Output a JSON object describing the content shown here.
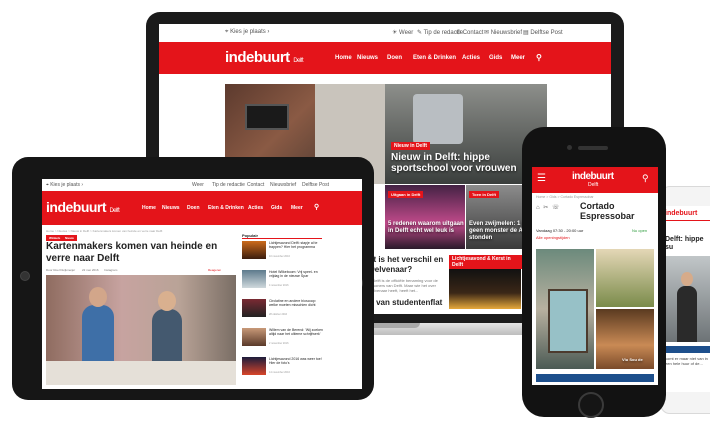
{
  "colors": {
    "brand_red": "#e4141a",
    "device_dark": "#161616"
  },
  "laptop": {
    "topbar": {
      "location": "Kies je plaats",
      "links": [
        "Weer",
        "Tip de redactie",
        "Contact",
        "Nieuwsbrief",
        "Delftse Post"
      ]
    },
    "logo": {
      "brand": "indebuurt",
      "city": "Delft"
    },
    "nav": [
      "Home",
      "Nieuws",
      "Doen",
      "Eten & Drinken",
      "Acties",
      "Gids",
      "Meer"
    ],
    "hero": {
      "tag": "Nieuw in Delft",
      "title": "Nieuw in Delft: hippe sportschool voor vrouwen"
    },
    "tiles": [
      {
        "tag": "Uitgaan in Delft",
        "title": "5 redenen waarom uitgaan in Delft echt wel leuk is"
      },
      {
        "tag": "Toen in Delft",
        "title": "Even zwijmelen: 1 nog geen monster de A13 stonden"
      }
    ],
    "article": {
      "title": "at is het verschil en Delvenaar?",
      "body": "n Delft is de officiële benaming voor de inwoners van Delft. Maar wie het over Delvenaar heeft, heeft het...",
      "footer": "n van studentenflat"
    },
    "side_tag": "Lichtjesavond & Kerst in Delft"
  },
  "tablet": {
    "topbar": {
      "location": "Kies je plaats",
      "links": [
        "Weer",
        "Tip de redactie",
        "Contact",
        "Nieuwsbrief",
        "Delftse Post"
      ]
    },
    "logo": {
      "brand": "indebuurt",
      "city": "Delft"
    },
    "nav": [
      "Home",
      "Nieuws",
      "Doen",
      "Eten & Drinken",
      "Acties",
      "Gids",
      "Meer"
    ],
    "breadcrumb": "Home > Nieuws > Nieuw in Delft > Kartenmakers komen van heinde en verre naar Delft",
    "tags": [
      "Winkels",
      "Nieuw"
    ],
    "title": "Kartenmakers komen van heinde en verre naar Delft",
    "byline": {
      "author": "Door Roel Duijkmeijer",
      "date": "22 mei 2016",
      "reacties": "Reageren",
      "share": "Instagram"
    },
    "popular": {
      "heading": "Populair",
      "items": [
        {
          "title": "Lichtjesavond Delft: stapje al te trappen? Hier het programma",
          "date": "10 november 2016"
        },
        {
          "title": "Hotel Wilkeboom: Vrij speel- en vrijdag in de nieuwe Spar",
          "date": "4 november 2016"
        },
        {
          "title": "Circlatine en andere bioscoop: welke moeten misschien dicht",
          "date": "28 oktober 2016"
        },
        {
          "title": "Willem van de Berend: 'Wij zoeken altijd naar het ultieme schrijfwerk'",
          "date": "2 november 2016"
        },
        {
          "title": "Lichtjesavond 2016 was weer toe! Hier de foto's",
          "date": "14 november 2016"
        }
      ]
    }
  },
  "phone": {
    "logo": {
      "brand": "indebuurt",
      "city": "Delft"
    },
    "breadcrumb": "Home > Gids > Cortado Espressobar",
    "title": "Cortado Espressobar",
    "status": "Nu open",
    "hours": "Vandaag 07:30 - 20:00 uur",
    "link": "Alle openingstijden",
    "photo_caption": "Vlu Sou de"
  },
  "phone2": {
    "logo": "indebuurt",
    "headline": "Delft: hippe su",
    "body": "komt er maar niet van in een hele huur of de..."
  }
}
